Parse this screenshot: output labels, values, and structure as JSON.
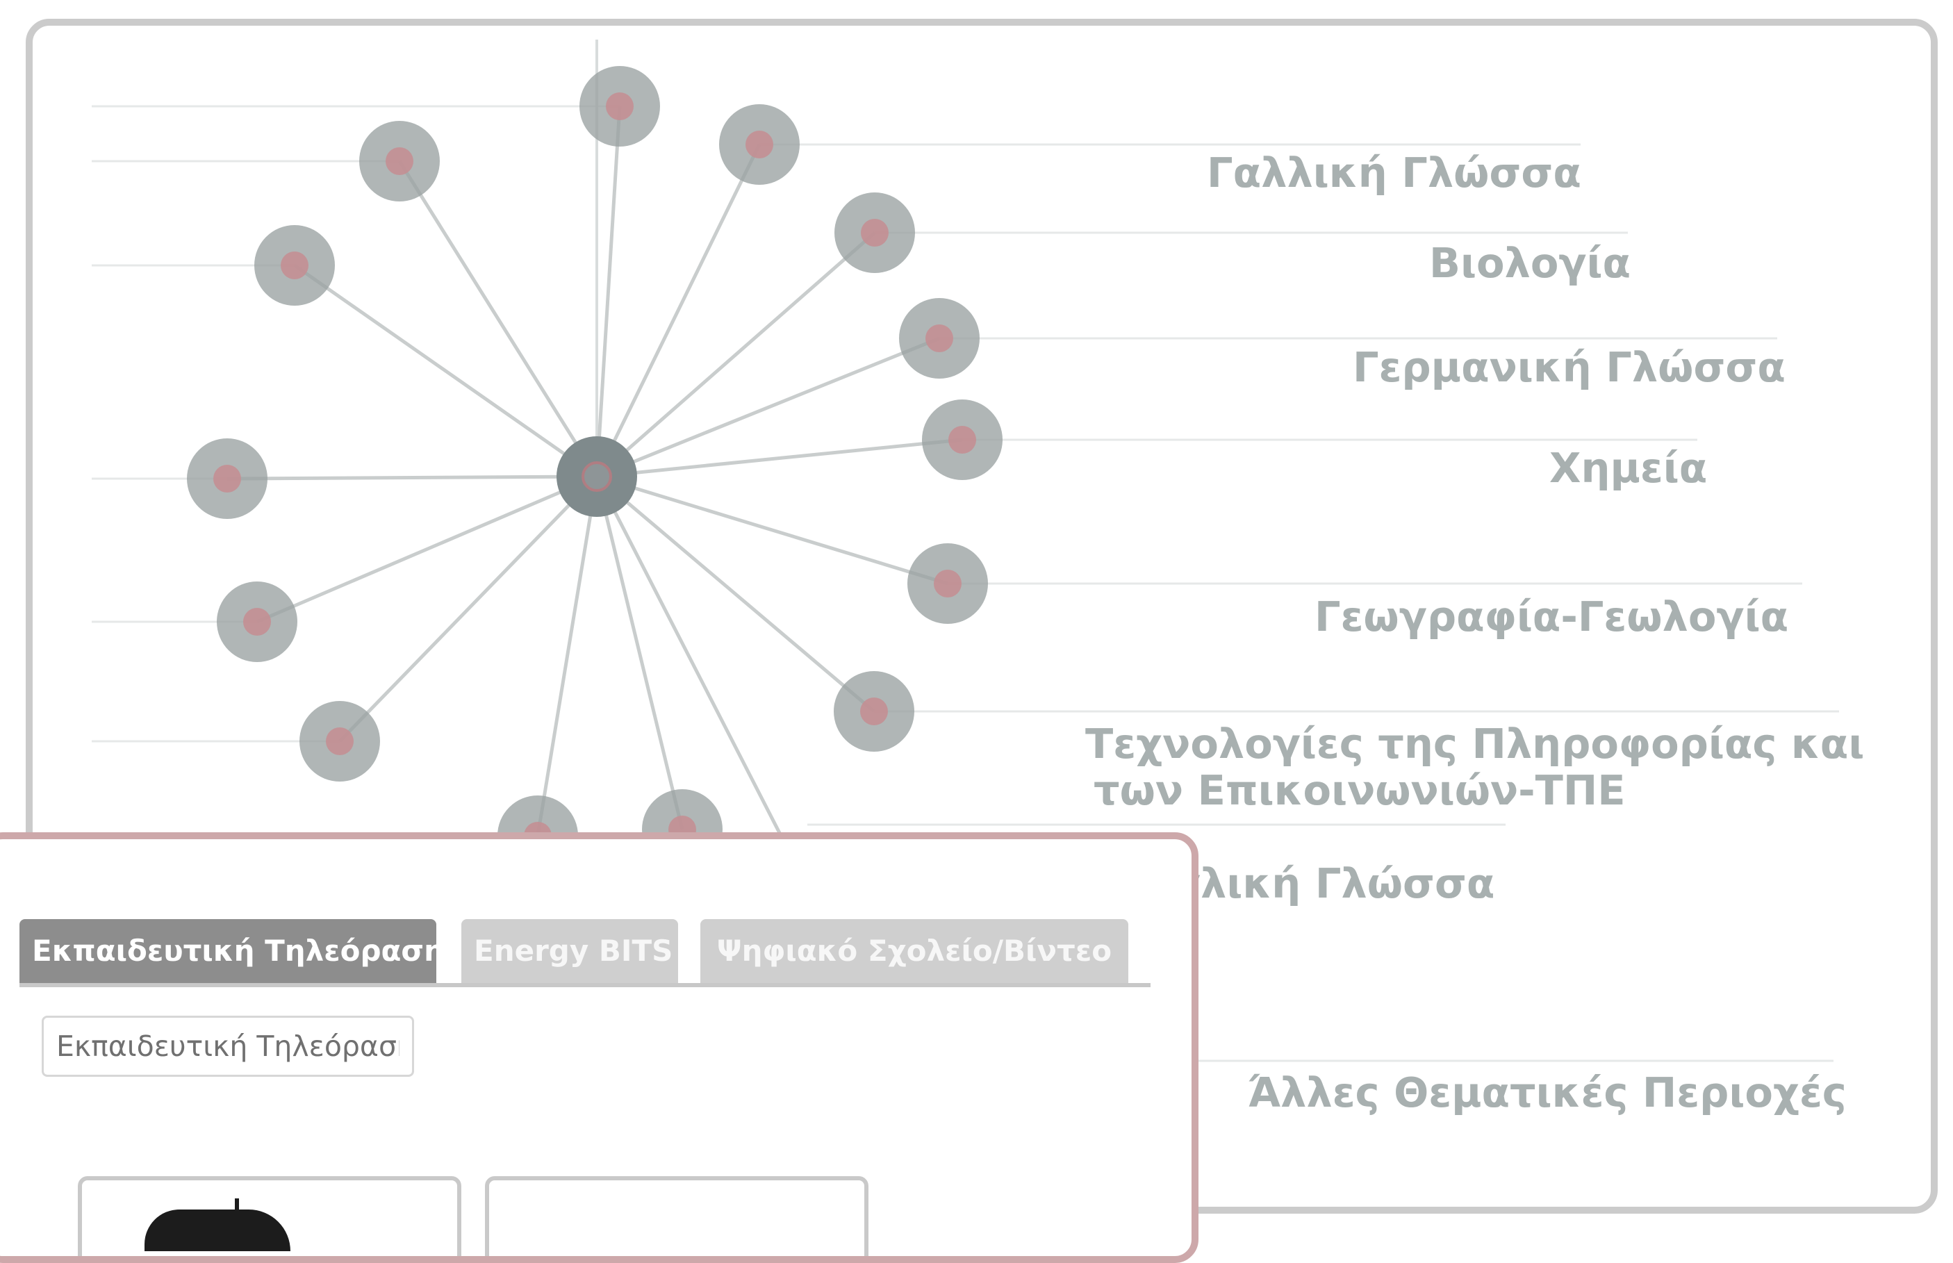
{
  "radial_chart": {
    "subjects": [
      "Γαλλική Γλώσσα",
      "Βιολογία",
      "Γερμανική Γλώσσα",
      "Χημεία",
      "Γεωγραφία-Γεωλογία",
      "Τεχνολογίες της Πληροφορίας και",
      "των Επικοινωνιών-ΤΠΕ",
      "Αγγλική Γλώσσα",
      "Άλλες Θεματικές Περιοχές"
    ],
    "colors": {
      "node": "#9aa2a2",
      "node_center": "#c58d92",
      "hub": "#7f8a8c",
      "spoke": "#c9cdcd",
      "label": "#a8b0b0"
    }
  },
  "panel": {
    "tabs": [
      {
        "label": "Εκπαιδευτική Τηλεόραση",
        "active": true
      },
      {
        "label": "Energy BITS",
        "active": false
      },
      {
        "label": "Ψηφιακό Σχολείο/Βίντεο",
        "active": false
      }
    ],
    "search_value": "Εκπαιδευτική Τηλεόραση",
    "accent_border": "#cda8aa"
  }
}
